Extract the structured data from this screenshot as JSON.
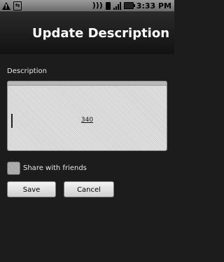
{
  "status_bar": {
    "time": "3:33 PM",
    "icons": [
      "warning-icon",
      "usb-icon",
      "wifi-icon",
      "sim-icon",
      "signal-icon",
      "battery-icon"
    ]
  },
  "header": {
    "title": "Update Description"
  },
  "form": {
    "description_label": "Description",
    "char_counter": "340",
    "share_label": "Share with friends",
    "share_checked": false,
    "save_label": "Save",
    "cancel_label": "Cancel"
  }
}
